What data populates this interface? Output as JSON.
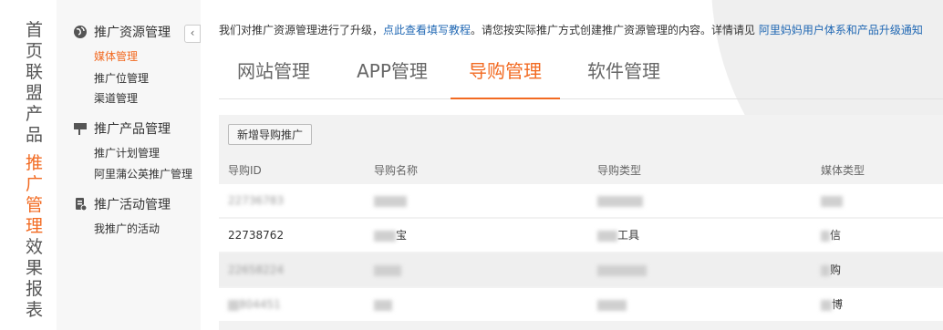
{
  "nav": {
    "items": [
      "首页",
      "联盟产品",
      "推广管理",
      "效果报表"
    ]
  },
  "sidebar": {
    "collapse_glyph": "‹",
    "groups": [
      {
        "icon": "globe-icon",
        "title": "推广资源管理",
        "items": [
          "媒体管理",
          "推广位管理",
          "渠道管理"
        ]
      },
      {
        "icon": "flag-icon",
        "title": "推广产品管理",
        "items": [
          "推广计划管理",
          "阿里蒲公英推广管理"
        ]
      },
      {
        "icon": "activity-icon",
        "title": "推广活动管理",
        "items": [
          "我推广的活动"
        ]
      }
    ]
  },
  "notice": {
    "text_before": "我们对推广资源管理进行了升级，",
    "link1": "点此查看填写教程",
    "text_middle": "。请您按实际推广方式创建推广资源管理的内容。详情请见",
    "link2": "阿里妈妈用户体系和产品升级通知"
  },
  "tabs": [
    "网站管理",
    "APP管理",
    "导购管理",
    "软件管理"
  ],
  "active_tab": "导购管理",
  "toolbar": {
    "add_label": "新增导购推广"
  },
  "table": {
    "columns": [
      "导购ID",
      "导购名称",
      "导购类型",
      "媒体类型"
    ],
    "rows": [
      {
        "id": "22736783",
        "name": "",
        "type": "",
        "media": ""
      },
      {
        "id": "22738762",
        "name": "宝",
        "type": "工具",
        "media": "信"
      },
      {
        "id": "22658224",
        "name": "",
        "type": "",
        "media": "购"
      },
      {
        "id": "804451",
        "name": "",
        "type": "",
        "media": "博"
      }
    ]
  },
  "colors": {
    "accent": "#f26a21",
    "link": "#1f67b3",
    "sidebar_bg": "#f7f7f7",
    "panel_bg": "#f2f2f2"
  }
}
